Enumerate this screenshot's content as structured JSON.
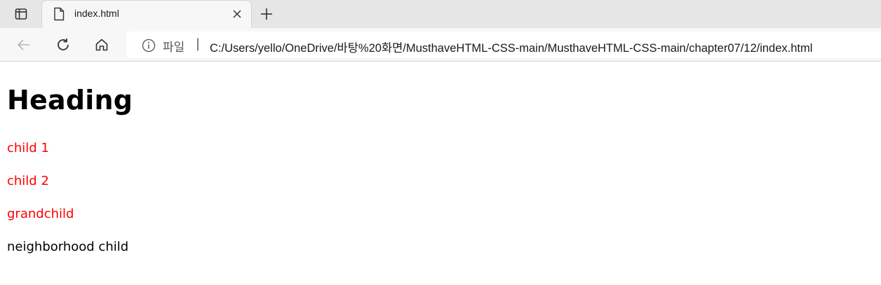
{
  "browser": {
    "tab": {
      "title": "index.html",
      "close_label": "×"
    },
    "new_tab_label": "+",
    "address": {
      "scheme_label": "파일",
      "separator": "|",
      "url": "C:/Users/yello/OneDrive/바탕%20화면/MusthaveHTML-CSS-main/MusthaveHTML-CSS-main/chapter07/12/index.html"
    }
  },
  "page": {
    "heading": "Heading",
    "items": [
      {
        "text": "child 1",
        "color": "#ff0000"
      },
      {
        "text": "child 2",
        "color": "#ff0000"
      },
      {
        "text": "grandchild",
        "color": "#ff0000"
      },
      {
        "text": "neighborhood child",
        "color": "#000000"
      }
    ]
  }
}
